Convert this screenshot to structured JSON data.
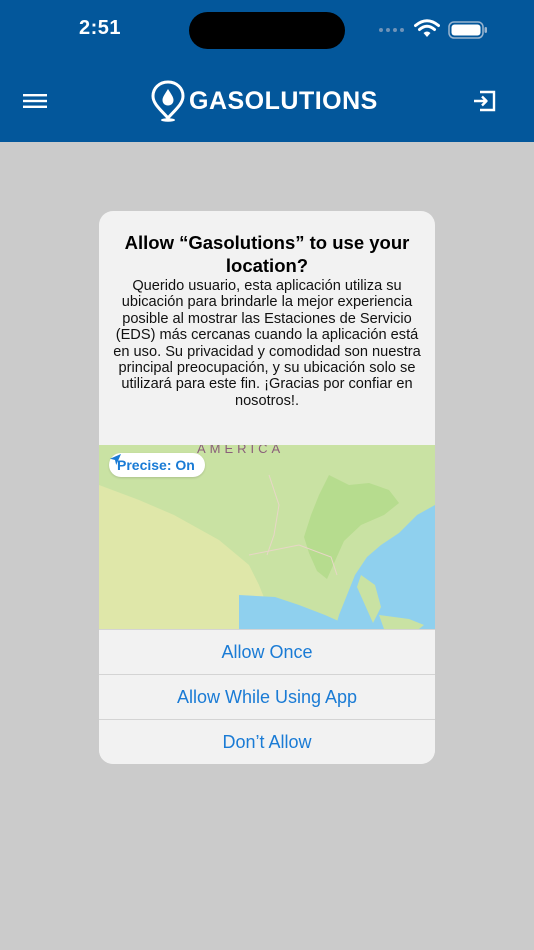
{
  "status_bar": {
    "time": "2:51"
  },
  "header": {
    "brand": "GASOLUTIONS"
  },
  "dialog": {
    "title": "Allow “Gasolutions” to use your location?",
    "message": "Querido usuario, esta aplicación utiliza su ubicación para brindarle la mejor experiencia posible al mostrar las Estaciones de Servicio (EDS) más cercanas cuando la aplicación está en uso. Su privacidad y comodidad son nuestra principal preocupación, y su ubicación solo se utilizará para este fin. ¡Gracias por confiar en nosotros!.",
    "map_label": "AMERICA",
    "precise_label": "Precise: On",
    "buttons": {
      "allow_once": "Allow Once",
      "allow_while_using": "Allow While Using App",
      "dont_allow": "Don’t Allow"
    }
  },
  "colors": {
    "header_bg": "#03579b",
    "overlay_bg": "#cbcbcb",
    "dialog_bg": "#f2f2f2",
    "accent": "#1a7bd5"
  }
}
